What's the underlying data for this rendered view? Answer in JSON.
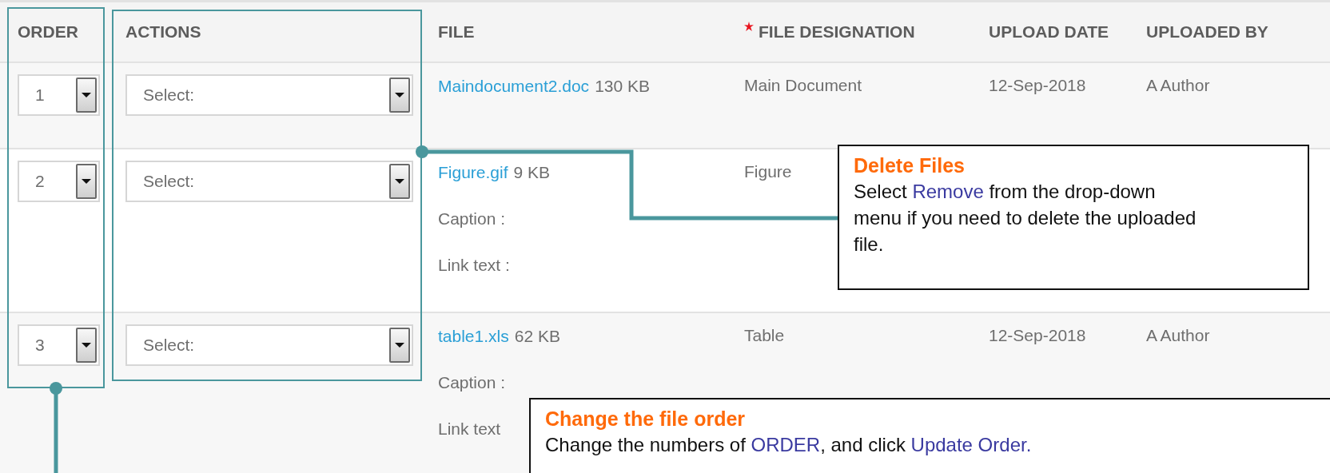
{
  "table": {
    "columns": [
      {
        "label": "ORDER",
        "required": false
      },
      {
        "label": "ACTIONS",
        "required": false
      },
      {
        "label": "FILE",
        "required": false
      },
      {
        "label": "FILE DESIGNATION",
        "required": true
      },
      {
        "label": "UPLOAD DATE",
        "required": false
      },
      {
        "label": "UPLOADED BY",
        "required": false
      }
    ],
    "rows": [
      {
        "order": "1",
        "action": "Select:",
        "file_name": "Maindocument2.doc",
        "file_size": "130 KB",
        "designation": "Main Document",
        "upload_date": "12-Sep-2018",
        "uploaded_by": "A Author"
      },
      {
        "order": "2",
        "action": "Select:",
        "file_name": "Figure.gif",
        "file_size": "9 KB",
        "details": [
          "Caption :",
          "Link text :"
        ],
        "designation": "Figure"
      },
      {
        "order": "3",
        "action": "Select:",
        "file_name": "table1.xls",
        "file_size": "62 KB",
        "details": [
          "Caption :",
          "Link text"
        ],
        "designation": "Table",
        "upload_date": "12-Sep-2018",
        "uploaded_by": "A Author"
      }
    ]
  },
  "callouts": [
    {
      "title": "Delete Files",
      "body": [
        {
          "kind": "plain",
          "text": "Select "
        },
        {
          "kind": "term",
          "text": "Remove"
        },
        {
          "kind": "plain",
          "text": " from the drop-down menu if you need to delete the uploaded file."
        }
      ]
    },
    {
      "title": "Change the file order",
      "body": [
        {
          "kind": "plain",
          "text": "Change the numbers of "
        },
        {
          "kind": "term",
          "text": "ORDER"
        },
        {
          "kind": "plain",
          "text": ", and click "
        },
        {
          "kind": "term",
          "text": "Update Order."
        }
      ]
    }
  ]
}
